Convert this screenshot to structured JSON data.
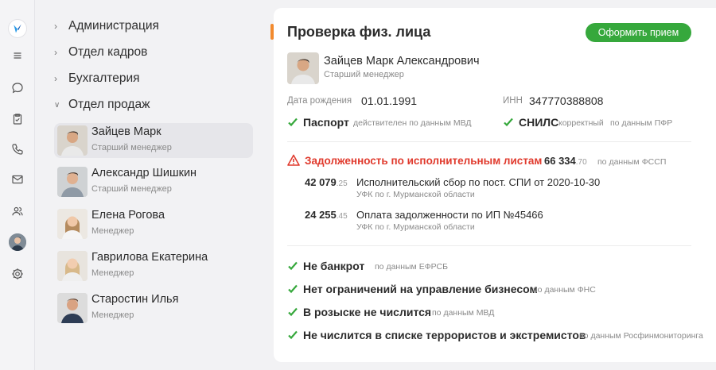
{
  "sidebar_rail": {
    "icons": [
      "logo-icon",
      "menu-icon",
      "chat-icon",
      "clipboard-check-icon",
      "phone-icon",
      "mail-icon",
      "users-icon",
      "avatar",
      "gear-icon"
    ]
  },
  "tree": {
    "departments": [
      {
        "label": "Администрация",
        "expanded": false
      },
      {
        "label": "Отдел кадров",
        "expanded": false
      },
      {
        "label": "Бухгалтерия",
        "expanded": false
      },
      {
        "label": "Отдел продаж",
        "expanded": true
      }
    ],
    "employees": [
      {
        "name": "Зайцев Марк",
        "role": "Старший менеджер",
        "selected": true
      },
      {
        "name": "Александр Шишкин",
        "role": "Старший менеджер",
        "selected": false
      },
      {
        "name": "Елена Рогова",
        "role": "Менеджер",
        "selected": false
      },
      {
        "name": "Гаврилова Екатерина",
        "role": "Менеджер",
        "selected": false
      },
      {
        "name": "Старостин Илья",
        "role": "Менеджер",
        "selected": false
      }
    ]
  },
  "check": {
    "title": "Проверка физ. лица",
    "action_button": "Оформить прием",
    "person": {
      "name": "Зайцев Марк Александрович",
      "role": "Старший менеджер"
    },
    "birth_label": "Дата рождения",
    "birth_value": "01.01.1991",
    "inn_label": "ИНН",
    "inn_value": "347770388808",
    "passport": {
      "label": "Паспорт",
      "status": "действителен по данным МВД"
    },
    "snils": {
      "label": "СНИЛС",
      "status": "корректный",
      "source": "по данным ПФР"
    },
    "debt": {
      "title": "Задолженность по исполнительным листам",
      "total_main": "66 334",
      "total_cents": ".70",
      "source": "по данным ФССП",
      "items": [
        {
          "amount_main": "42 079",
          "amount_cents": ".25",
          "text": "Исполнительский сбор по пост. СПИ от 2020-10-30",
          "org": "УФК по г. Мурманской области"
        },
        {
          "amount_main": "24 255",
          "amount_cents": ".45",
          "text": "Оплата задолженности по ИП №45466",
          "org": "УФК по г. Мурманской области"
        }
      ]
    },
    "results": [
      {
        "label": "Не банкрот",
        "source": "по данным ЕФРСБ"
      },
      {
        "label": "Нет ограничений на управление бизнесом",
        "source": "по данным ФНС"
      },
      {
        "label": "В розыске не числится",
        "source": "по данным МВД"
      },
      {
        "label": "Не числится в списке террористов и экстремистов",
        "source": "по данным Росфинмониторинга"
      }
    ]
  },
  "colors": {
    "accent": "#f28a2e",
    "success": "#36a83c",
    "danger": "#e03a2d"
  }
}
